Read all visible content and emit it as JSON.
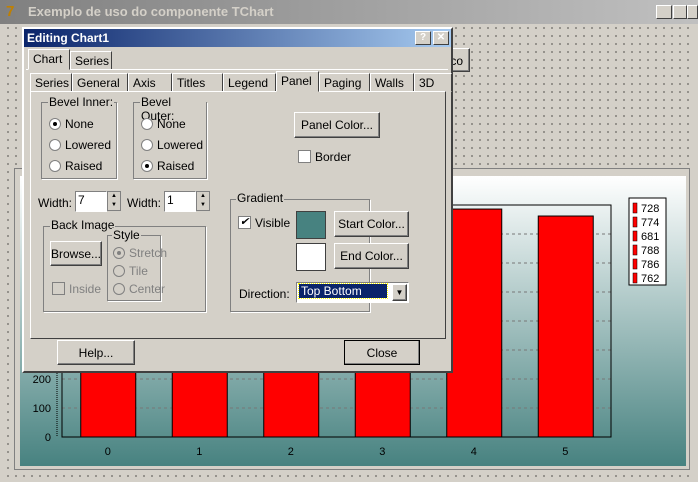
{
  "window": {
    "title": "Exemplo de uso do componente TChart",
    "behind_button": "co"
  },
  "dialog": {
    "title": "Editing Chart1",
    "help_btn": "?",
    "close_x": "✕",
    "top_tabs": [
      "Chart",
      "Series"
    ],
    "sub_tabs": [
      "Series",
      "General",
      "Axis",
      "Titles",
      "Legend",
      "Panel",
      "Paging",
      "Walls",
      "3D"
    ],
    "bevel_inner": {
      "label": "Bevel Inner:",
      "options": [
        "None",
        "Lowered",
        "Raised"
      ],
      "selected": "None"
    },
    "bevel_outer": {
      "label": "Bevel Outer:",
      "options": [
        "None",
        "Lowered",
        "Raised"
      ],
      "selected": "Raised"
    },
    "panel_color": "Panel Color...",
    "border_label": "Border",
    "border_checked": false,
    "width_label": "Width:",
    "inner_width": "7",
    "outer_width": "1",
    "back_image": {
      "label": "Back Image",
      "browse": "Browse...",
      "inside": "Inside",
      "style_label": "Style",
      "styles": [
        "Stretch",
        "Tile",
        "Center"
      ]
    },
    "gradient": {
      "label": "Gradient",
      "visible": "Visible",
      "visible_checked": true,
      "start_color_btn": "Start Color...",
      "end_color_btn": "End Color...",
      "start_color": "#478280",
      "end_color": "#ffffff",
      "direction_label": "Direction:",
      "direction": "Top Bottom"
    },
    "help": "Help...",
    "close": "Close"
  },
  "chart_data": {
    "type": "bar",
    "categories": [
      "0",
      "1",
      "2",
      "3",
      "4",
      "5"
    ],
    "values": [
      728,
      774,
      681,
      788,
      786,
      762
    ],
    "ylim": [
      0,
      800
    ],
    "yticks": [
      "0",
      "100",
      "200"
    ],
    "bar_color": "#ff0000",
    "legend": [
      "728",
      "774",
      "681",
      "788",
      "786",
      "762"
    ],
    "legend_position": "right"
  }
}
